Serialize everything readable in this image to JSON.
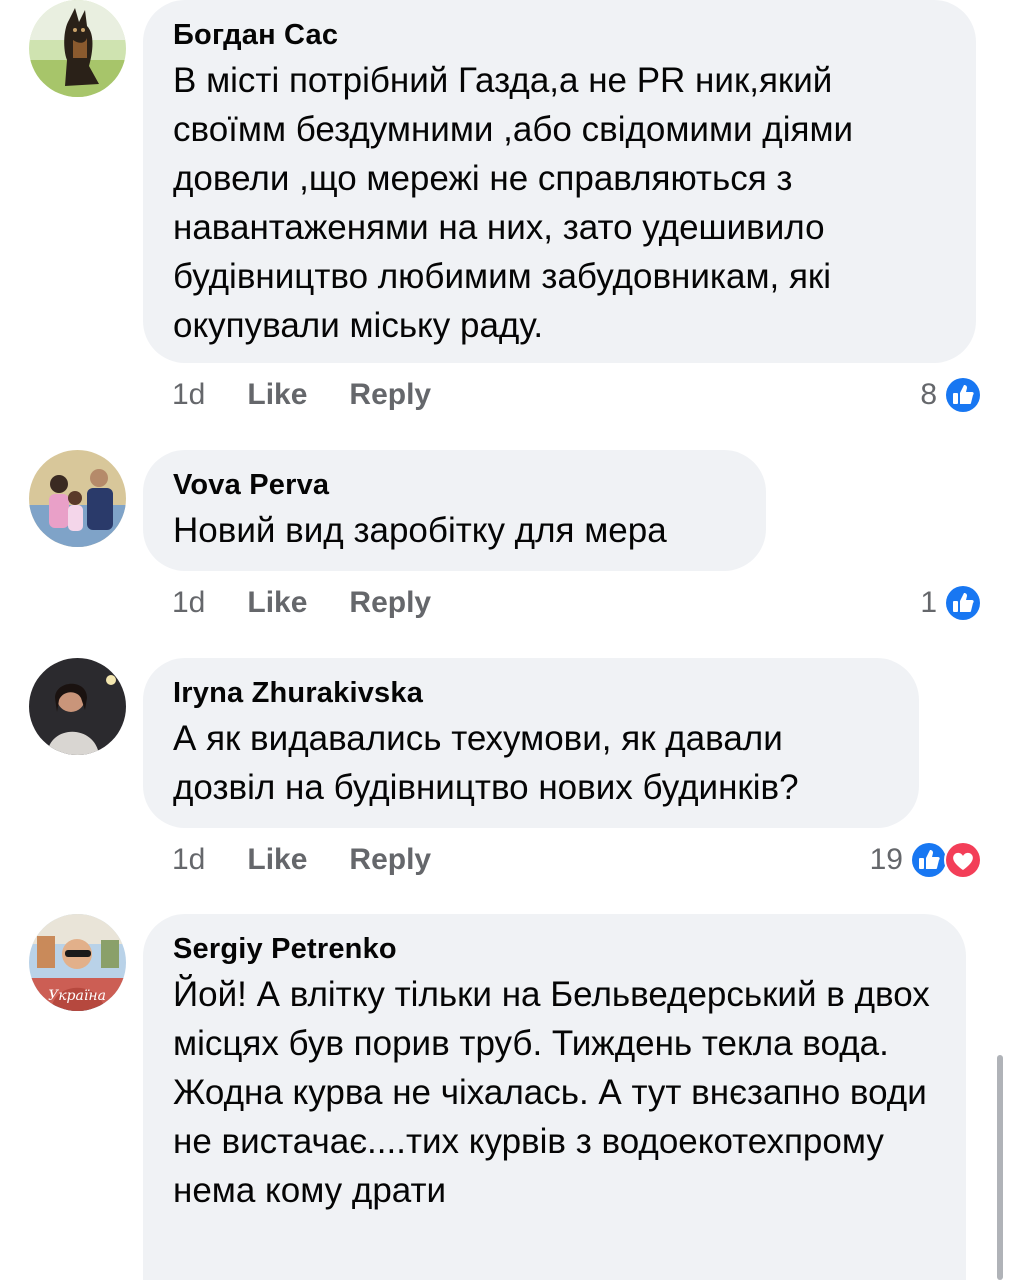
{
  "comments": [
    {
      "author": "Богдан Сас",
      "text": "В місті потрібний Газда,а не PR ник,який своїмм бездумними ,або свідомими діями довели ,що мережі не справляються з навантаженями на них, зато удешивило  будівництво  любимим забудовникам, які окупували міську раду.",
      "time": "1d",
      "like_label": "Like",
      "reply_label": "Reply",
      "reaction_count": "8",
      "reactions": [
        "like-icon"
      ]
    },
    {
      "author": "Vova Perva",
      "text": "Новий вид заробітку для мера",
      "time": "1d",
      "like_label": "Like",
      "reply_label": "Reply",
      "reaction_count": "1",
      "reactions": [
        "like-icon"
      ]
    },
    {
      "author": "Iryna Zhurakivska",
      "text": "А як видавались техумови, як давали дозвіл на будівництво нових будинків?",
      "time": "1d",
      "like_label": "Like",
      "reply_label": "Reply",
      "reaction_count": "19",
      "reactions": [
        "like-icon",
        "love-icon"
      ]
    },
    {
      "author": "Sergiy Petrenko",
      "text": "Йой! А влітку тільки на Бельведерський в двох місцях був порив труб. Тиждень текла вода. Жодна курва не чіхалась. А тут внєзапно води не вистачає....тих курвів з водоекотехпрому нема кому драти",
      "avatar_caption": "Україна",
      "reactions": []
    }
  ],
  "colors": {
    "bubble": "#f0f2f5",
    "meta_text": "#65676b",
    "like_blue": "#1877f2",
    "love_red": "#f33e58"
  }
}
